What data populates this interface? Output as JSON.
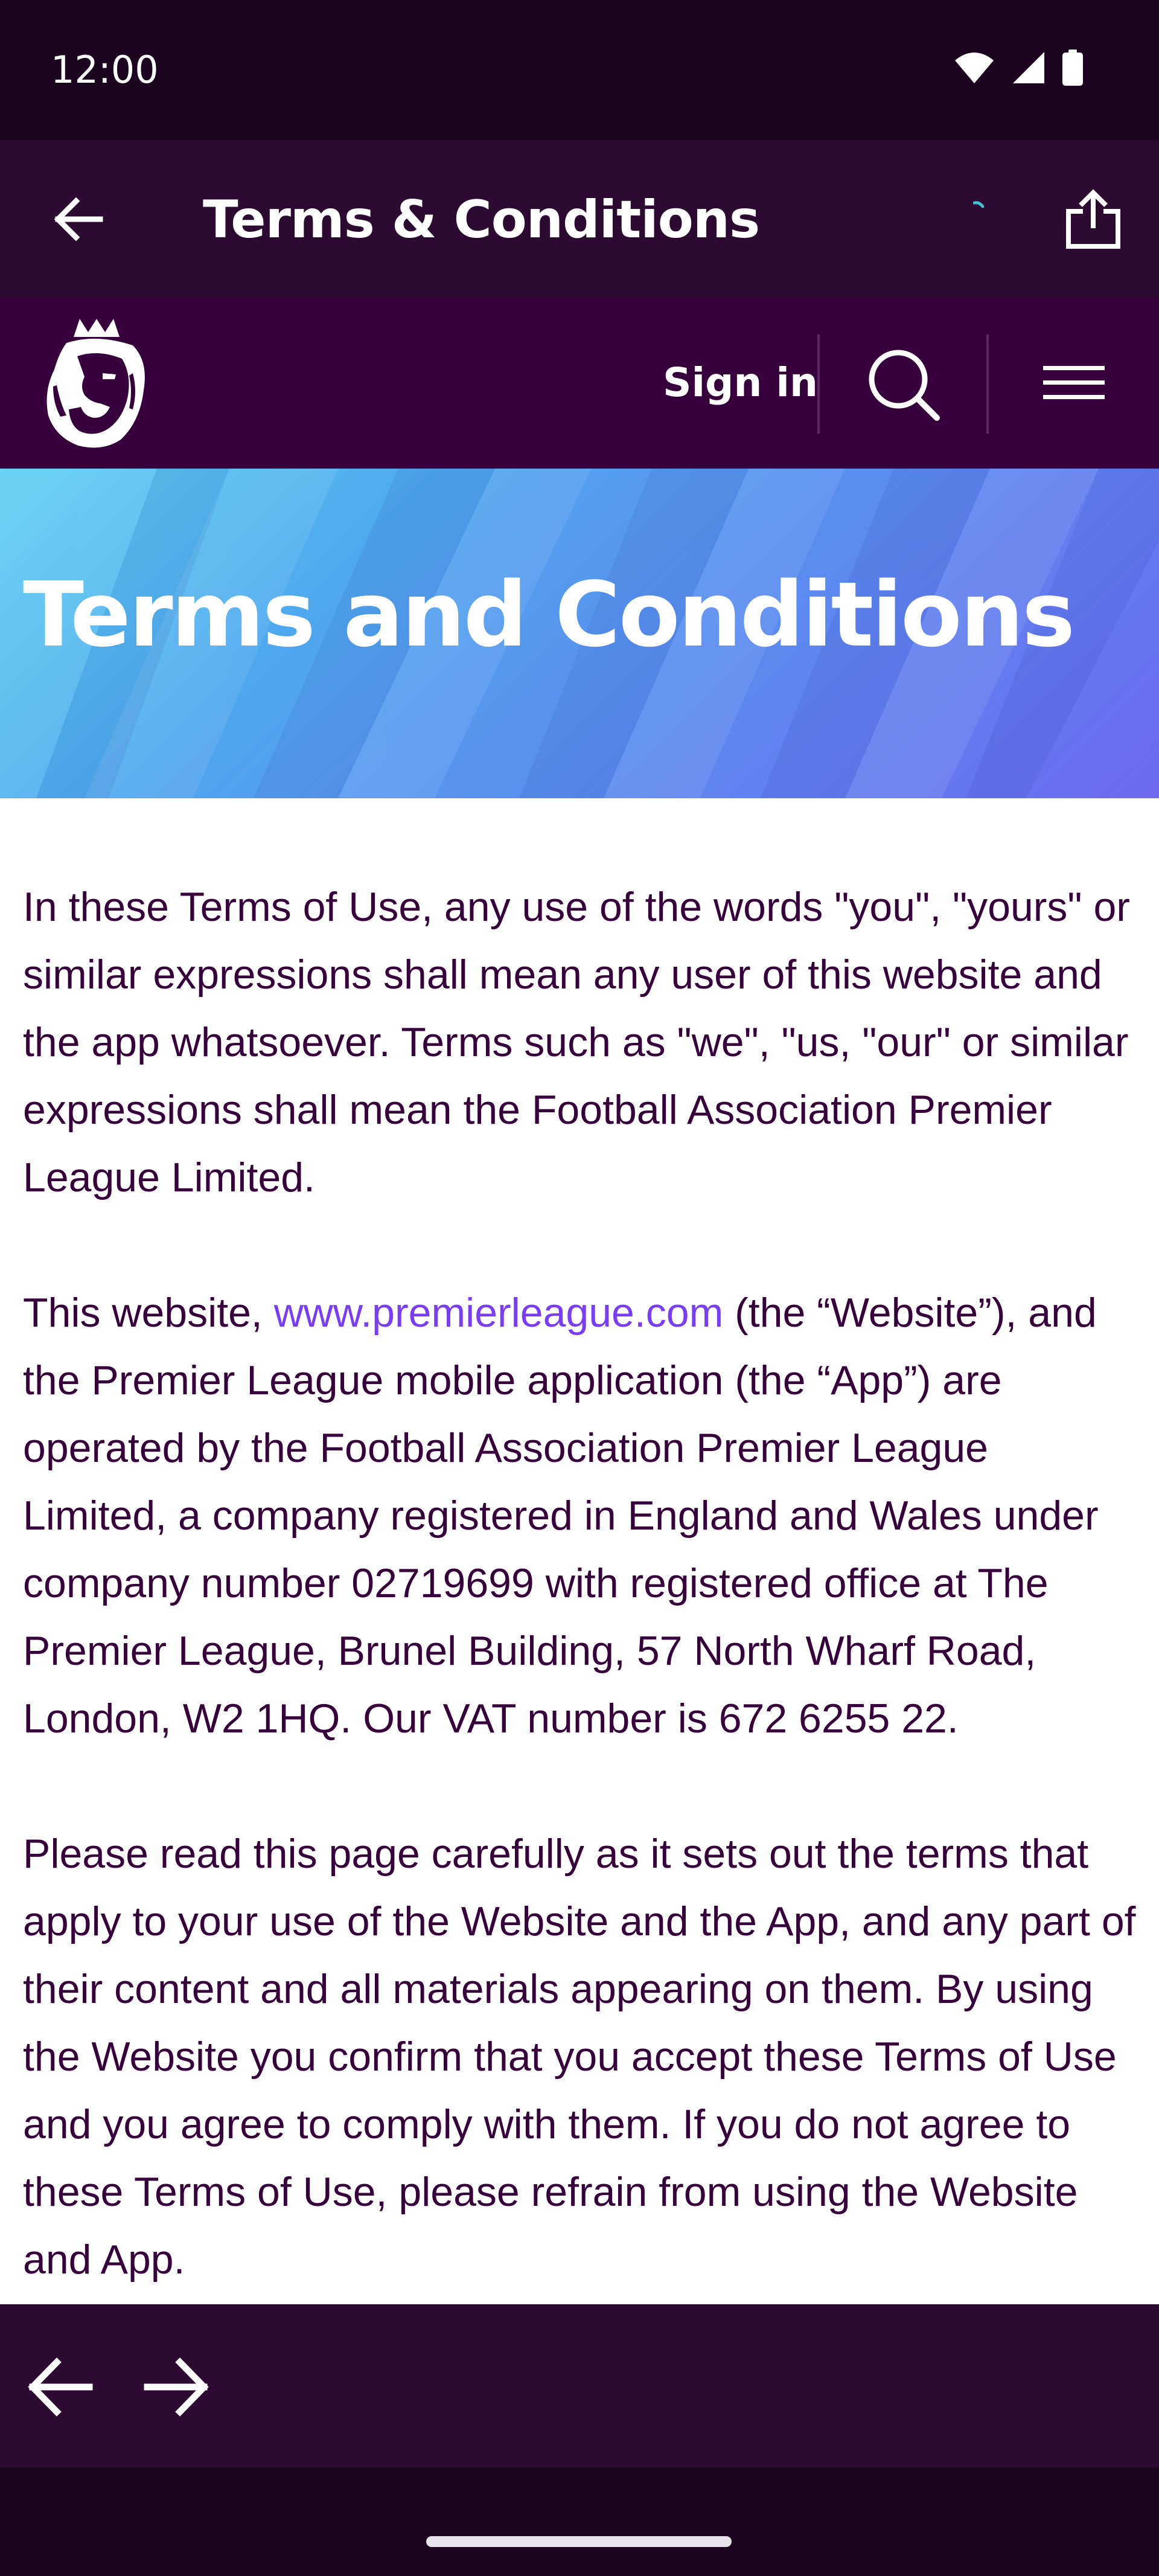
{
  "status_bar": {
    "time": "12:00",
    "icons": [
      "wifi-icon",
      "cell-signal-icon",
      "battery-icon"
    ]
  },
  "app_bar": {
    "title": "Terms & Conditions",
    "back_icon": "arrow-back-icon",
    "share_icon": "share-icon"
  },
  "site_header": {
    "logo": "premier-league-lion-logo",
    "sign_in_label": "Sign in",
    "search_icon": "search-icon",
    "menu_icon": "hamburger-menu-icon"
  },
  "hero": {
    "title": "Terms and Conditions"
  },
  "content": {
    "p1": "In these Terms of Use, any use of the words \"you\", \"yours\" or similar expressions shall mean any user of this website and the app whatsoever. Terms such as \"we\", \"us, \"our\" or similar expressions shall mean the Football Association Premier League Limited.",
    "p2_before_link": "This website, ",
    "p2_link": "www.premierleague.com",
    "p2_after_link": " (the “Website”), and the Premier League mobile application (the “App”) are operated by the Football Association Premier League Limited, a company registered in England and Wales under company number 02719699 with registered office at The Premier League, Brunel Building, 57 North Wharf Road, London, W2 1HQ. Our VAT number is 672 6255 22.",
    "p3": "Please read this page carefully as it sets out the terms that apply to your use of the Website and the App, and any part of their content and all materials appearing on them. By using the Website you confirm that you accept these Terms of Use and you agree to comply with them. If you do not agree to these Terms of Use, please refrain from using the Website and App."
  },
  "browser_nav": {
    "back_icon": "arrow-back-icon",
    "forward_icon": "arrow-forward-icon"
  },
  "colors": {
    "status_bg": "#1c0420",
    "app_bar_bg": "#2d0a31",
    "header_bg": "#37003c",
    "body_text": "#37003c",
    "link": "#7b3df0",
    "hero_start": "#5fd0f2",
    "hero_end": "#6d6af0"
  }
}
